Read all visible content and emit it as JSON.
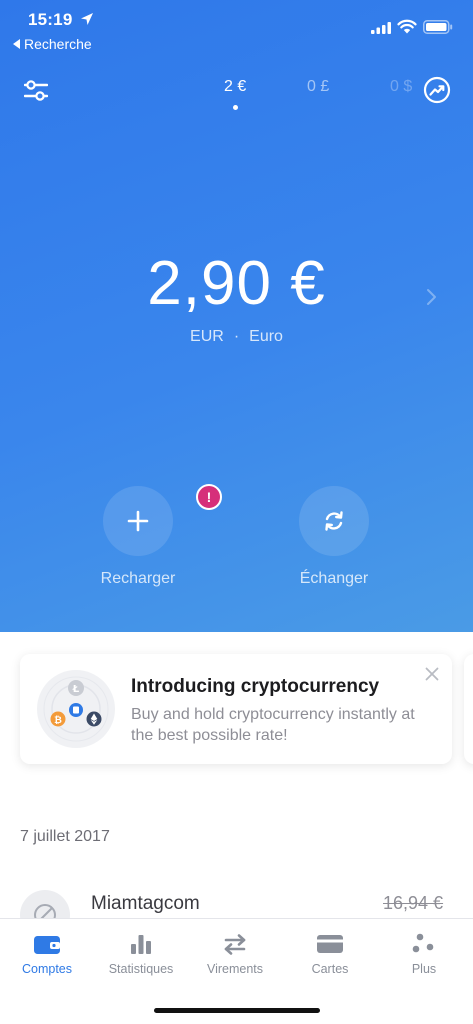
{
  "status": {
    "time": "15:19",
    "back_label": "Recherche"
  },
  "header": {
    "tabs": [
      {
        "label": "2 €",
        "active": true
      },
      {
        "label": "0 £",
        "active": false
      },
      {
        "label": "0 $",
        "active": false
      }
    ]
  },
  "balance": {
    "amount": "2,90 €",
    "code": "EUR",
    "separator": "·",
    "currency_name": "Euro"
  },
  "actions": [
    {
      "label": "Recharger",
      "icon": "plus-icon",
      "badge": "!"
    },
    {
      "label": "Échanger",
      "icon": "exchange-icon"
    }
  ],
  "promo": {
    "title": "Introducing cryptocurrency",
    "text": "Buy and hold cryptocurrency instantly at the best possible rate!"
  },
  "transactions": {
    "date": "7 juillet 2017",
    "items": [
      {
        "name": "Miamtagcom",
        "amount": "16,94 €",
        "status": "reverted"
      }
    ]
  },
  "tabbar": {
    "items": [
      {
        "label": "Comptes",
        "icon": "wallet-icon",
        "active": true
      },
      {
        "label": "Statistiques",
        "icon": "bar-chart-icon",
        "active": false
      },
      {
        "label": "Virements",
        "icon": "transfer-icon",
        "active": false
      },
      {
        "label": "Cartes",
        "icon": "card-icon",
        "active": false
      },
      {
        "label": "Plus",
        "icon": "more-icon",
        "active": false
      }
    ]
  },
  "colors": {
    "primary": "#2f7ae5",
    "hero_start": "#2f78ea",
    "hero_end": "#4a9be6",
    "alert_badge": "#d62f7a"
  }
}
